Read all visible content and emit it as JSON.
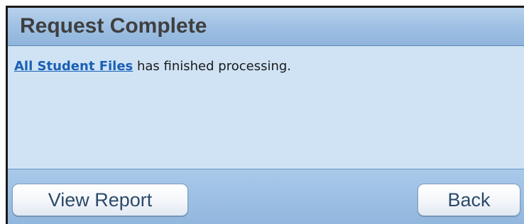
{
  "dialog": {
    "title": "Request Complete",
    "message": {
      "link_text": "All Student Files",
      "text": " has finished processing."
    },
    "buttons": {
      "view_report": "View Report",
      "back": "Back"
    }
  }
}
